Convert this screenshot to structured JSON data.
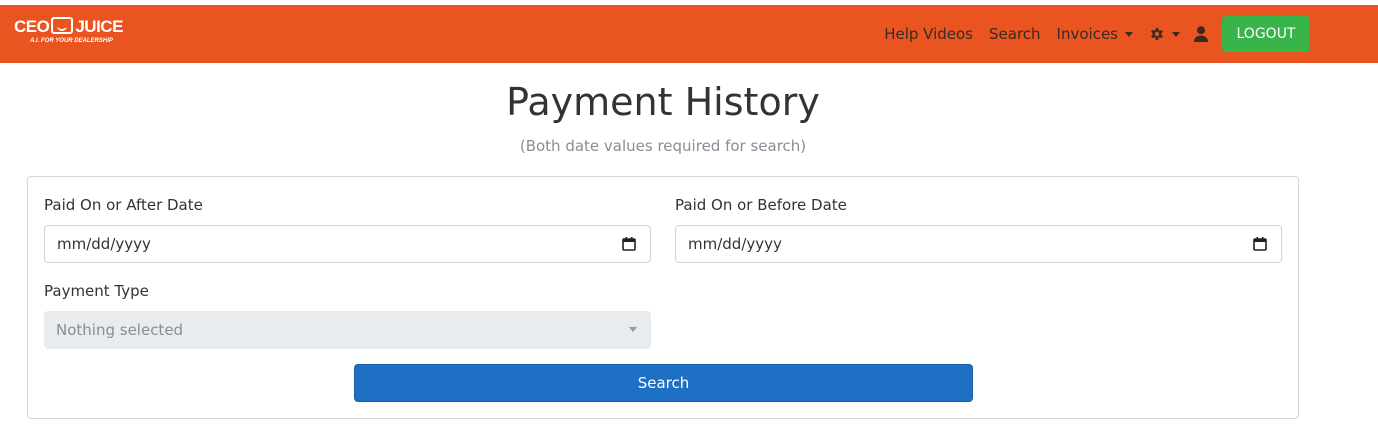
{
  "app": {
    "logo_text_left": "CEO",
    "logo_text_right": "JUICE",
    "tagline": "A.I. FOR YOUR DEALERSHIP",
    "brand_color": "#e95420"
  },
  "nav": {
    "help_videos": "Help Videos",
    "search": "Search",
    "invoices": "Invoices",
    "settings_icon": "gear-icon",
    "user_icon": "user-icon",
    "logout": "LOGOUT"
  },
  "page": {
    "title": "Payment History",
    "subtitle": "(Both date values required for search)"
  },
  "form": {
    "paid_after_label": "Paid On or After Date",
    "paid_after_value": "mm/dd/yyyy",
    "paid_before_label": "Paid On or Before Date",
    "paid_before_value": "mm/dd/yyyy",
    "payment_type_label": "Payment Type",
    "payment_type_value": "Nothing selected",
    "search_button": "Search",
    "accent_color": "#1e70c4"
  }
}
